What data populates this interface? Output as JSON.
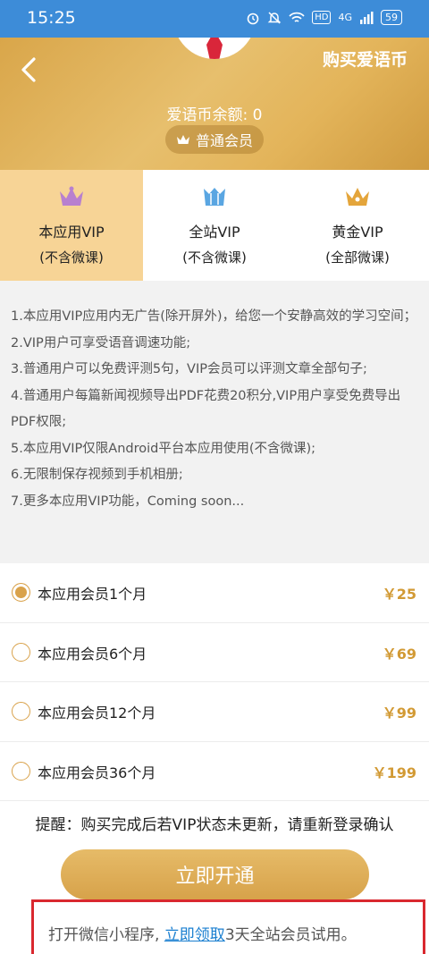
{
  "status_bar": {
    "time": "15:25",
    "icons": [
      "alarm-icon",
      "mute-icon",
      "wifi-icon",
      "hd-icon",
      "signal-icon"
    ],
    "hd_label": "HD",
    "network_label": "4G",
    "battery": "59"
  },
  "header": {
    "title": "购买爱语币",
    "balance_text": "爱语币余额: 0",
    "member_badge": "普通会员",
    "colors": {
      "gold": "#d9a64a"
    }
  },
  "tabs": [
    {
      "label": "本应用VIP",
      "sub": "(不含微课)",
      "active": true,
      "crown_color": "#b880cf"
    },
    {
      "label": "全站VIP",
      "sub": "(不含微课)",
      "active": false,
      "crown_color": "#5aa6e2"
    },
    {
      "label": "黄金VIP",
      "sub": "(全部微课)",
      "active": false,
      "crown_color": "#e4a53b"
    }
  ],
  "features": [
    "1.本应用VIP应用内无广告(除开屏外)，给您一个安静高效的学习空间；",
    "2.VIP用户可享受语音调速功能;",
    "3.普通用户可以免费评测5句，VIP会员可以评测文章全部句子;",
    "4.普通用户每篇新闻视频导出PDF花费20积分,VIP用户享受免费导出PDF权限;",
    "5.本应用VIP仅限Android平台本应用使用(不含微课);",
    "6.无限制保存视频到手机相册;",
    "7.更多本应用VIP功能，Coming soon..."
  ],
  "plans": [
    {
      "name": "本应用会员1个月",
      "price": "￥25",
      "selected": true
    },
    {
      "name": "本应用会员6个月",
      "price": "￥69",
      "selected": false
    },
    {
      "name": "本应用会员12个月",
      "price": "￥99",
      "selected": false
    },
    {
      "name": "本应用会员36个月",
      "price": "￥199",
      "selected": false
    }
  ],
  "reminder": "提醒：购买完成后若VIP状态未更新，请重新登录确认",
  "open_button": "立即开通",
  "promo": {
    "prefix": "打开微信小程序, ",
    "link": "立即领取",
    "suffix": "3天全站会员试用。"
  }
}
